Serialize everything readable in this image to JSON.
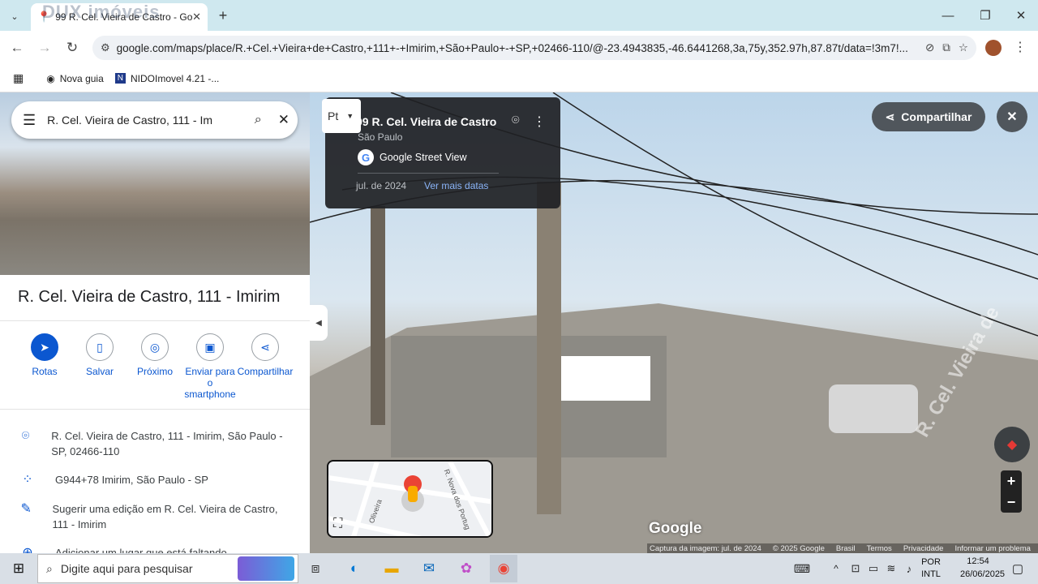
{
  "browser": {
    "tab_title": "99 R. Cel. Vieira de Castro - Goo",
    "new_tab_symbol": "+",
    "url": "google.com/maps/place/R.+Cel.+Vieira+de+Castro,+111+-+Imirim,+São+Paulo+-+SP,+02466-110/@-23.4943835,-46.6441268,3a,75y,352.97h,87.87t/data=!3m7!...",
    "bookmarks": [
      {
        "label": "Nova guia",
        "icon": "globe-icon"
      },
      {
        "label": "NIDOImovel 4.21 -...",
        "icon": "nido-icon"
      }
    ],
    "watermark": "DUX imóveis"
  },
  "panel": {
    "search_query": "R. Cel. Vieira de Castro, 111 - Im",
    "title": "R. Cel. Vieira de Castro, 111 - Imirim",
    "actions": [
      {
        "label": "Rotas",
        "icon": "directions-icon"
      },
      {
        "label": "Salvar",
        "icon": "bookmark-icon"
      },
      {
        "label": "Próximo",
        "icon": "nearby-icon"
      },
      {
        "label": "Enviar para o smartphone",
        "icon": "phone-icon"
      },
      {
        "label": "Compartilhar",
        "icon": "share-icon"
      }
    ],
    "info": [
      {
        "text": "R. Cel. Vieira de Castro, 111 - Imirim, São Paulo - SP, 02466-110",
        "icon": "location-pin-icon"
      },
      {
        "text": "G944+78 Imirim, São Paulo - SP",
        "icon": "plus-code-icon"
      },
      {
        "text": "Sugerir uma edição em R. Cel. Vieira de Castro, 111 - Imirim",
        "icon": "edit-pencil-icon"
      },
      {
        "text": "Adicionar um lugar que está faltando",
        "icon": "add-place-icon"
      }
    ]
  },
  "streetview": {
    "pt_label": "Pt",
    "card_title": "99 R. Cel. Vieira de Castro",
    "card_subtitle": "São Paulo",
    "card_source": "Google Street View",
    "card_date": "jul. de 2024",
    "card_more": "Ver mais datas",
    "share_label": "Compartilhar",
    "google_logo": "Google",
    "minimap_street_1": "R. Nova dos Portug",
    "minimap_street_2": "Oliveira",
    "footer": [
      "Captura da imagem: jul. de 2024",
      "© 2025 Google",
      "Brasil",
      "Termos",
      "Privacidade",
      "Informar um problema"
    ],
    "street_sign_text": "R. Cel. Vieira de"
  },
  "taskbar": {
    "search_placeholder": "Digite aqui para pesquisar",
    "language": "POR",
    "layout": "INTL",
    "time": "12:54",
    "date": "26/06/2025"
  },
  "colors": {
    "accent": "#0b57d0",
    "tabstrip": "#cfe8ef",
    "card": "#202124"
  }
}
